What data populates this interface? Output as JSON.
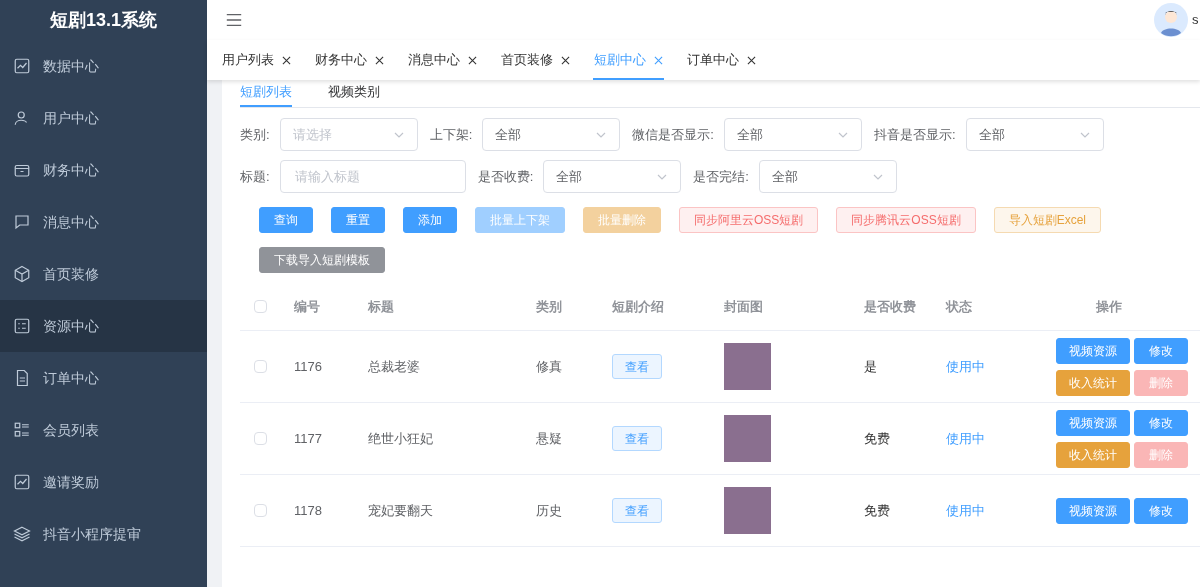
{
  "sidebar": {
    "title": "短剧13.1系统",
    "items": [
      {
        "label": "数据中心",
        "selected": false
      },
      {
        "label": "用户中心",
        "selected": false
      },
      {
        "label": "财务中心",
        "selected": false
      },
      {
        "label": "消息中心",
        "selected": false
      },
      {
        "label": "首页装修",
        "selected": false
      },
      {
        "label": "资源中心",
        "selected": true
      },
      {
        "label": "订单中心",
        "selected": false
      },
      {
        "label": "会员列表",
        "selected": false
      },
      {
        "label": "邀请奖励",
        "selected": false
      },
      {
        "label": "抖音小程序提审",
        "selected": false
      }
    ]
  },
  "header": {
    "username": "s"
  },
  "tabs": [
    {
      "label": "用户列表",
      "selected": false
    },
    {
      "label": "财务中心",
      "selected": false
    },
    {
      "label": "消息中心",
      "selected": false
    },
    {
      "label": "首页装修",
      "selected": false
    },
    {
      "label": "短剧中心",
      "selected": true
    },
    {
      "label": "订单中心",
      "selected": false
    }
  ],
  "subtabs": [
    {
      "label": "短剧列表",
      "selected": true
    },
    {
      "label": "视频类别",
      "selected": false
    }
  ],
  "filters": [
    [
      {
        "label": "类别:",
        "kind": "select",
        "placeholder": "请选择"
      },
      {
        "label": "上下架:",
        "kind": "select",
        "value": "全部"
      },
      {
        "label": "微信是否显示:",
        "kind": "select",
        "value": "全部"
      },
      {
        "label": "抖音是否显示:",
        "kind": "select",
        "value": "全部"
      }
    ],
    [
      {
        "label": "标题:",
        "kind": "input",
        "placeholder": "请输入标题"
      },
      {
        "label": "是否收费:",
        "kind": "select",
        "value": "全部"
      },
      {
        "label": "是否完结:",
        "kind": "select",
        "value": "全部"
      }
    ]
  ],
  "buttons": [
    [
      {
        "label": "查询",
        "kind": "primary"
      },
      {
        "label": "重置",
        "kind": "primary"
      },
      {
        "label": "添加",
        "kind": "primary"
      },
      {
        "label": "批量上下架",
        "kind": "primary-light"
      },
      {
        "label": "批量删除",
        "kind": "warning-light"
      },
      {
        "label": "同步阿里云OSS短剧",
        "kind": "danger-plain"
      },
      {
        "label": "同步腾讯云OSS短剧",
        "kind": "danger-plain"
      },
      {
        "label": "导入短剧Excel",
        "kind": "warning-plain"
      }
    ],
    [
      {
        "label": "下载导入短剧模板",
        "kind": "info"
      }
    ]
  ],
  "table": {
    "all_checked": false,
    "columns": [
      "编号",
      "标题",
      "类别",
      "短剧介绍",
      "封面图",
      "是否收费",
      "状态",
      "操作"
    ],
    "rows": [
      {
        "checked": false,
        "id": "1176",
        "title": "总裁老婆",
        "category": "修真",
        "intro_button": "查看",
        "paid": "是",
        "status": "使用中",
        "actions": [
          {
            "label": "视频资源",
            "kind": "primary"
          },
          {
            "label": "修改",
            "kind": "primary"
          },
          {
            "label": "收入统计",
            "kind": "warning"
          },
          {
            "label": "删除",
            "kind": "danger-light"
          }
        ]
      },
      {
        "checked": false,
        "id": "1177",
        "title": "绝世小狂妃",
        "category": "悬疑",
        "intro_button": "查看",
        "paid": "免费",
        "status": "使用中",
        "actions": [
          {
            "label": "视频资源",
            "kind": "primary"
          },
          {
            "label": "修改",
            "kind": "primary"
          },
          {
            "label": "收入统计",
            "kind": "warning"
          },
          {
            "label": "删除",
            "kind": "danger-light"
          }
        ]
      },
      {
        "checked": false,
        "id": "1178",
        "title": "宠妃要翻天",
        "category": "历史",
        "intro_button": "查看",
        "paid": "免费",
        "status": "使用中",
        "actions": [
          {
            "label": "视频资源",
            "kind": "primary"
          },
          {
            "label": "修改",
            "kind": "primary"
          }
        ]
      }
    ]
  }
}
